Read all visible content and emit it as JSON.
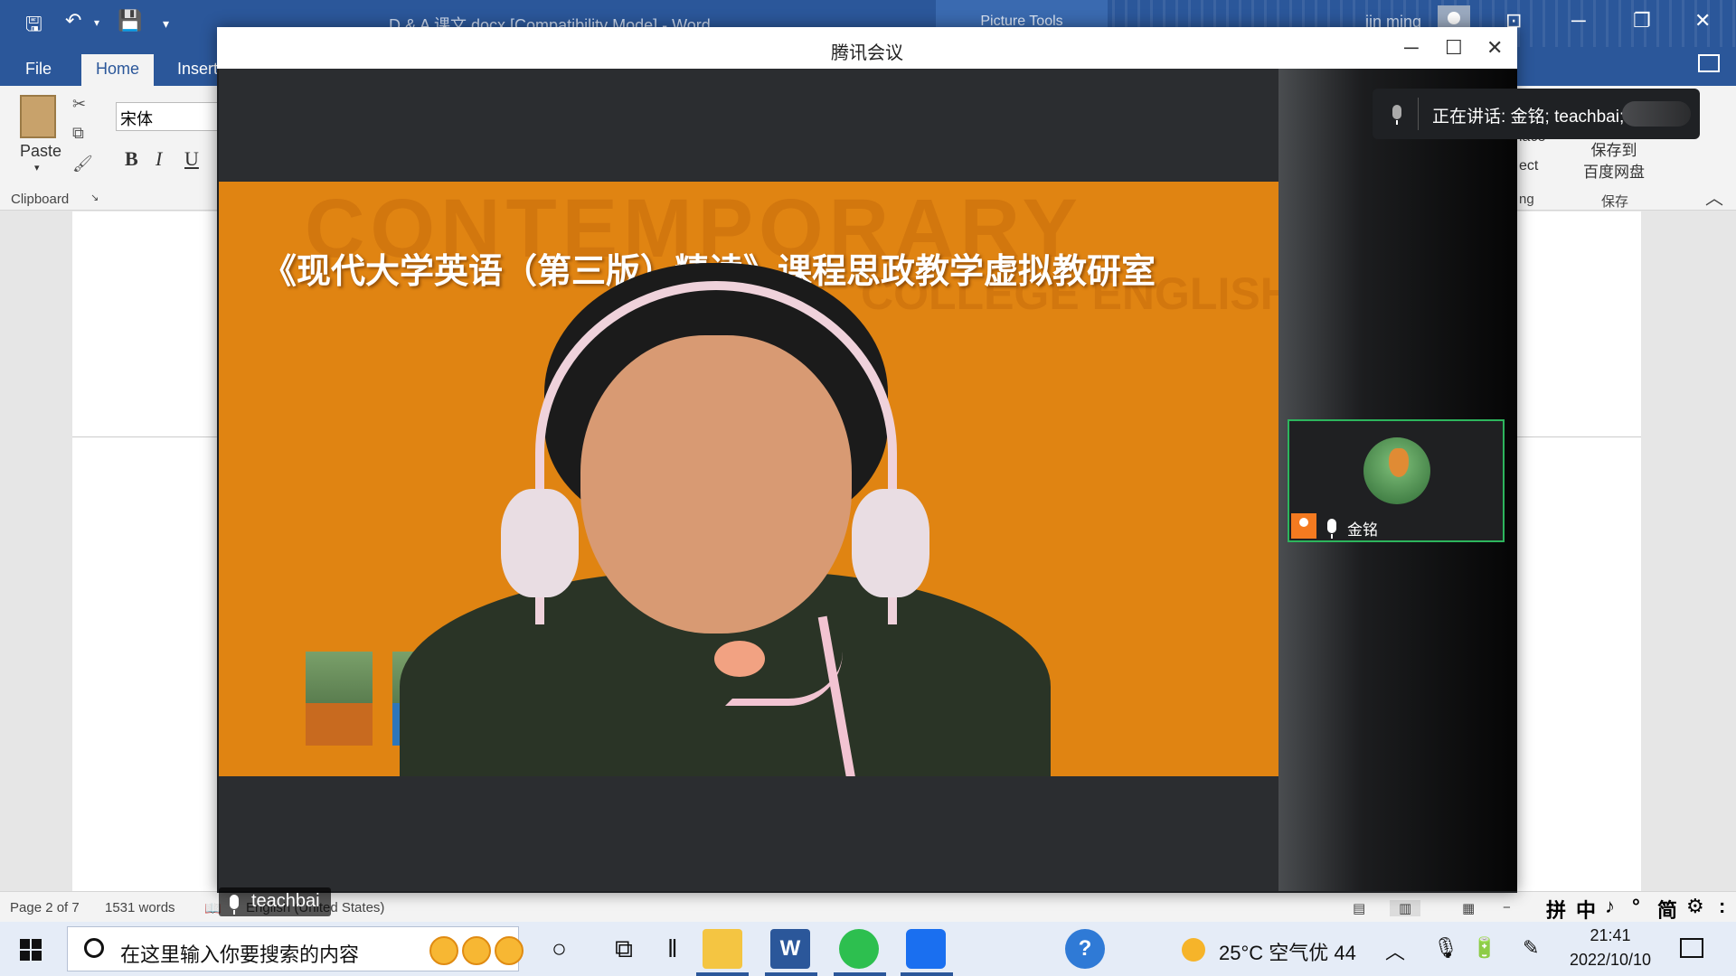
{
  "word": {
    "title": "D & A 课文.docx [Compatibility Mode]  -  Word",
    "picture_tools": "Picture Tools",
    "user": "jin ming",
    "tabs": [
      "File",
      "Home",
      "Insert"
    ],
    "paste_label": "Paste",
    "clipboard_label": "Clipboard",
    "font_name": "宋体",
    "format_buttons": [
      "B",
      "I",
      "U"
    ],
    "ribbon_partial": [
      "lace",
      "ect",
      "ng"
    ],
    "save_button": "保存到\n百度网盘",
    "save_group": "保存",
    "status": {
      "page": "Page 2 of 7",
      "words": "1531 words",
      "language": "English (United States)"
    }
  },
  "meeting": {
    "title": "腾讯会议",
    "slide_title": "《现代大学英语（第三版）精读》课程思政教学虚拟教研室",
    "background_text": "CONTEMPORARY",
    "background_text2": "COLLEGE ENGLISH",
    "main_speaker": "teachbai",
    "speaking_now": "正在讲话: 金铭; teachbai;",
    "participants": [
      {
        "name": "金铭",
        "role": "host"
      }
    ]
  },
  "taskbar": {
    "search_placeholder": "在这里输入你要搜索的内容",
    "weather": "25°C  空气优 44",
    "time": "21:41",
    "date": "2022/10/10"
  },
  "ime": [
    "拼",
    "中",
    "♪",
    "°",
    "简",
    "⚙",
    ":"
  ],
  "colors": {
    "word_blue": "#2b579a",
    "slide_orange": "#e08412",
    "active_border": "#2db55d",
    "host_badge": "#f47a20"
  }
}
